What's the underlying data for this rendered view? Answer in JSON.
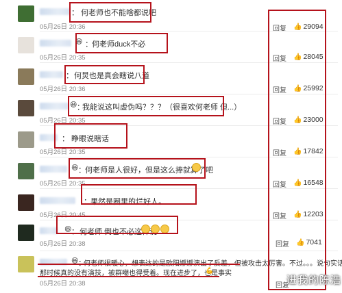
{
  "watermark": "进我的陈浩",
  "reply_label": "回复",
  "colon": "：",
  "comments": [
    {
      "text": "何老师也不能啥都说吧",
      "time": "05月26日 20:36",
      "likes": "29094",
      "emoji": false
    },
    {
      "text": "何老师duck不必",
      "time": "05月26日 20:35",
      "likes": "28045",
      "emoji": true
    },
    {
      "text": "何炅也是真会瞎说八道",
      "time": "05月26日 20:36",
      "likes": "25992",
      "emoji": false
    },
    {
      "text": "我能说这叫虚伪吗？？？（很喜欢何老师 但...）",
      "time": "05月26日 20:35",
      "likes": "23000",
      "emoji": true
    },
    {
      "text": "睁眼说瞎话",
      "time": "05月26日 20:35",
      "likes": "17842",
      "emoji": false
    },
    {
      "text": "何老师是人很好，但是这么捧就算了吧",
      "time": "05月26日 20:35",
      "likes": "16548",
      "emoji": true
    },
    {
      "text": "果然是圈里的烂好人。",
      "time": "05月26日 20:45",
      "likes": "12203",
      "emoji": false
    },
    {
      "text": "何老师 倒也不必这样说",
      "time": "05月26日 20:38",
      "likes": "7041",
      "emoji": true
    },
    {
      "text": "何老师很暖心，想表达的是欧阳娜娜演出了反差，但被攻击太厉害。不过。。。说句实话，",
      "text2": "那时候真的没有演技，被群嘲也得受着。现在进步了，也是事实",
      "time": "05月26日 20:38",
      "likes": "",
      "emoji": true
    }
  ]
}
